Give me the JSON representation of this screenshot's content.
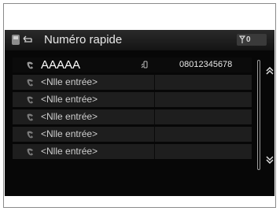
{
  "header": {
    "title": "Numéro rapide",
    "status": "0",
    "header_icon": "phone-back-icon",
    "status_icon": "signal-icon"
  },
  "rows": [
    {
      "label": "AAAAA",
      "number": "08012345678",
      "type_icon": "mobile-phone-icon",
      "selected": true
    },
    {
      "label": "<Nlle entrée>"
    },
    {
      "label": "<Nlle entrée>"
    },
    {
      "label": "<Nlle entrée>"
    },
    {
      "label": "<Nlle entrée>"
    },
    {
      "label": "<Nlle entrée>"
    }
  ],
  "scroll": {
    "up_icon": "double-chevron-up-icon",
    "down_icon": "double-chevron-down-icon"
  },
  "colors": {
    "screen": "#070707",
    "row": "#1e1e1e",
    "text": "#cfcfcf"
  }
}
